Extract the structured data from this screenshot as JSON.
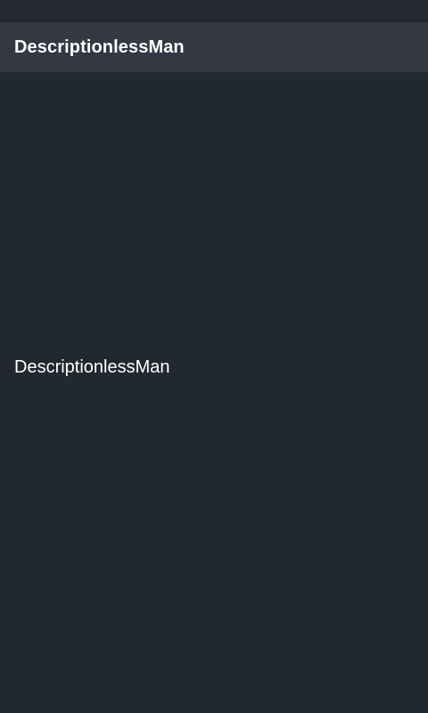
{
  "app_bar": {
    "title": "DescriptionlessMan"
  },
  "main": {
    "text": "DescriptionlessMan"
  },
  "colors": {
    "background": "#222830",
    "app_bar": "#333843",
    "text": "#ffffff"
  }
}
